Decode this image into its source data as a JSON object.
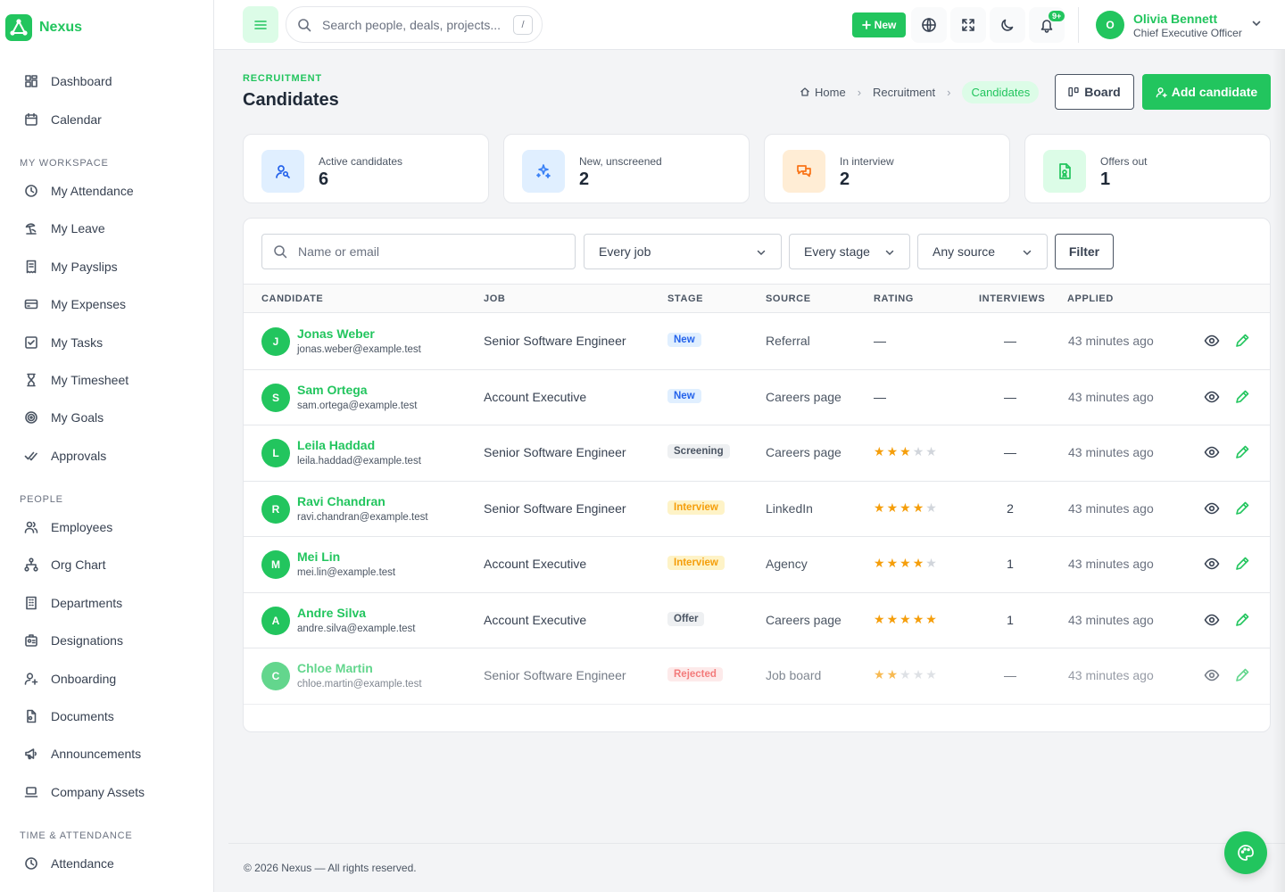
{
  "brand": {
    "name": "Nexus"
  },
  "sidebar": {
    "top_items": [
      {
        "label": "Dashboard",
        "icon": "dashboard-icon"
      },
      {
        "label": "Calendar",
        "icon": "calendar-icon"
      }
    ],
    "sections": [
      {
        "title": "MY WORKSPACE",
        "items": [
          {
            "label": "My Attendance",
            "icon": "clock-icon"
          },
          {
            "label": "My Leave",
            "icon": "beach-icon"
          },
          {
            "label": "My Payslips",
            "icon": "receipt-icon"
          },
          {
            "label": "My Expenses",
            "icon": "credit-card-icon"
          },
          {
            "label": "My Tasks",
            "icon": "checkbox-icon"
          },
          {
            "label": "My Timesheet",
            "icon": "hourglass-icon"
          },
          {
            "label": "My Goals",
            "icon": "target-icon"
          },
          {
            "label": "Approvals",
            "icon": "checks-icon"
          }
        ]
      },
      {
        "title": "PEOPLE",
        "items": [
          {
            "label": "Employees",
            "icon": "users-icon"
          },
          {
            "label": "Org Chart",
            "icon": "hierarchy-icon"
          },
          {
            "label": "Departments",
            "icon": "building-icon"
          },
          {
            "label": "Designations",
            "icon": "id-badge-icon"
          },
          {
            "label": "Onboarding",
            "icon": "user-plus-icon"
          },
          {
            "label": "Documents",
            "icon": "file-icon"
          },
          {
            "label": "Announcements",
            "icon": "megaphone-icon"
          },
          {
            "label": "Company Assets",
            "icon": "laptop-icon"
          }
        ]
      },
      {
        "title": "TIME & ATTENDANCE",
        "items": [
          {
            "label": "Attendance",
            "icon": "clock-icon"
          }
        ]
      }
    ]
  },
  "topbar": {
    "search_placeholder": "Search people, deals, projects...",
    "search_shortcut": "/",
    "new_label": "New",
    "notification_badge": "9+",
    "user": {
      "initial": "O",
      "name": "Olivia Bennett",
      "role": "Chief Executive Officer"
    }
  },
  "page": {
    "eyebrow": "RECRUITMENT",
    "title": "Candidates",
    "breadcrumb": [
      "Home",
      "Recruitment",
      "Candidates"
    ],
    "board_label": "Board",
    "add_label": "Add candidate"
  },
  "stats": [
    {
      "label": "Active candidates",
      "value": "6",
      "icon": "user-search-icon",
      "bg": "#e0efff",
      "color": "#2563eb"
    },
    {
      "label": "New, unscreened",
      "value": "2",
      "icon": "sparkles-icon",
      "bg": "#e0efff",
      "color": "#3b82f6"
    },
    {
      "label": "In interview",
      "value": "2",
      "icon": "chat-bubbles-icon",
      "bg": "#ffedd5",
      "color": "#f97316"
    },
    {
      "label": "Offers out",
      "value": "1",
      "icon": "file-offer-icon",
      "bg": "#dcfce7",
      "color": "#22c55e"
    }
  ],
  "filters": {
    "name_placeholder": "Name or email",
    "job": "Every job",
    "stage": "Every stage",
    "source": "Any source",
    "filter_label": "Filter"
  },
  "table": {
    "headers": [
      "CANDIDATE",
      "JOB",
      "STAGE",
      "SOURCE",
      "RATING",
      "INTERVIEWS",
      "APPLIED"
    ],
    "rows": [
      {
        "initial": "J",
        "name": "Jonas Weber",
        "email": "jonas.weber@example.test",
        "job": "Senior Software Engineer",
        "stage": "New",
        "stage_class": "b-new",
        "source": "Referral",
        "rating": 0,
        "interviews": "—",
        "applied": "43 minutes ago"
      },
      {
        "initial": "S",
        "name": "Sam Ortega",
        "email": "sam.ortega@example.test",
        "job": "Account Executive",
        "stage": "New",
        "stage_class": "b-new",
        "source": "Careers page",
        "rating": 0,
        "interviews": "—",
        "applied": "43 minutes ago"
      },
      {
        "initial": "L",
        "name": "Leila Haddad",
        "email": "leila.haddad@example.test",
        "job": "Senior Software Engineer",
        "stage": "Screening",
        "stage_class": "b-screening",
        "source": "Careers page",
        "rating": 3,
        "interviews": "—",
        "applied": "43 minutes ago"
      },
      {
        "initial": "R",
        "name": "Ravi Chandran",
        "email": "ravi.chandran@example.test",
        "job": "Senior Software Engineer",
        "stage": "Interview",
        "stage_class": "b-interview",
        "source": "LinkedIn",
        "rating": 4,
        "interviews": "2",
        "applied": "43 minutes ago"
      },
      {
        "initial": "M",
        "name": "Mei Lin",
        "email": "mei.lin@example.test",
        "job": "Account Executive",
        "stage": "Interview",
        "stage_class": "b-interview",
        "source": "Agency",
        "rating": 4,
        "interviews": "1",
        "applied": "43 minutes ago"
      },
      {
        "initial": "A",
        "name": "Andre Silva",
        "email": "andre.silva@example.test",
        "job": "Account Executive",
        "stage": "Offer",
        "stage_class": "b-offer",
        "source": "Careers page",
        "rating": 5,
        "interviews": "1",
        "applied": "43 minutes ago"
      },
      {
        "initial": "C",
        "name": "Chloe Martin",
        "email": "chloe.martin@example.test",
        "job": "Senior Software Engineer",
        "stage": "Rejected",
        "stage_class": "b-rejected",
        "source": "Job board",
        "rating": 2,
        "interviews": "—",
        "applied": "43 minutes ago",
        "dimmed": true
      }
    ],
    "empty_rating": "—"
  },
  "footer": {
    "text": "© 2026 Nexus — All rights reserved."
  },
  "colors": {
    "accent": "#22c55e",
    "star": "#f59e0b"
  }
}
